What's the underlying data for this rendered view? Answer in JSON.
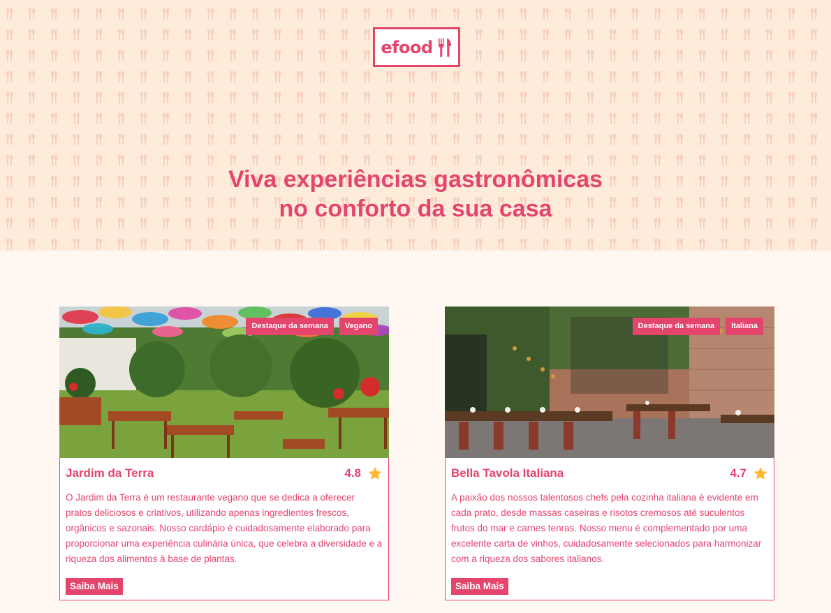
{
  "header": {
    "logo_text": "efood",
    "title_line1": "Viva experiências gastronômicas",
    "title_line2": "no conforto da sua casa"
  },
  "colors": {
    "primary": "#e4456d",
    "hero_bg": "#ffebd9",
    "page_bg": "#fff8f2",
    "star": "#ffb930"
  },
  "restaurants": [
    {
      "name": "Jardim da Terra",
      "rating": "4.8",
      "tags": [
        "Destaque da semana",
        "Vegano"
      ],
      "description": "O Jardim da Terra é um restaurante vegano que se dedica a oferecer pratos deliciosos e criativos, utilizando apenas ingredientes frescos, orgânicos e sazonais. Nosso cardápio é cuidadosamente elaborado para proporcionar uma experiência culinária única, que celebra a diversidade e a riqueza dos alimentos à base de plantas.",
      "button_label": "Saiba Mais",
      "icon": "star-icon"
    },
    {
      "name": "Bella Tavola Italiana",
      "rating": "4.7",
      "tags": [
        "Destaque da semana",
        "Italiana"
      ],
      "description": "A paixão dos nossos talentosos chefs pela cozinha italiana é evidente em cada prato, desde massas caseiras e risotos cremosos até suculentos frutos do mar e carnes tenras. Nosso menu é complementado por uma excelente carta de vinhos, cuidadosamente selecionados para harmonizar com a riqueza dos sabores italianos.",
      "button_label": "Saiba Mais",
      "icon": "star-icon"
    }
  ]
}
